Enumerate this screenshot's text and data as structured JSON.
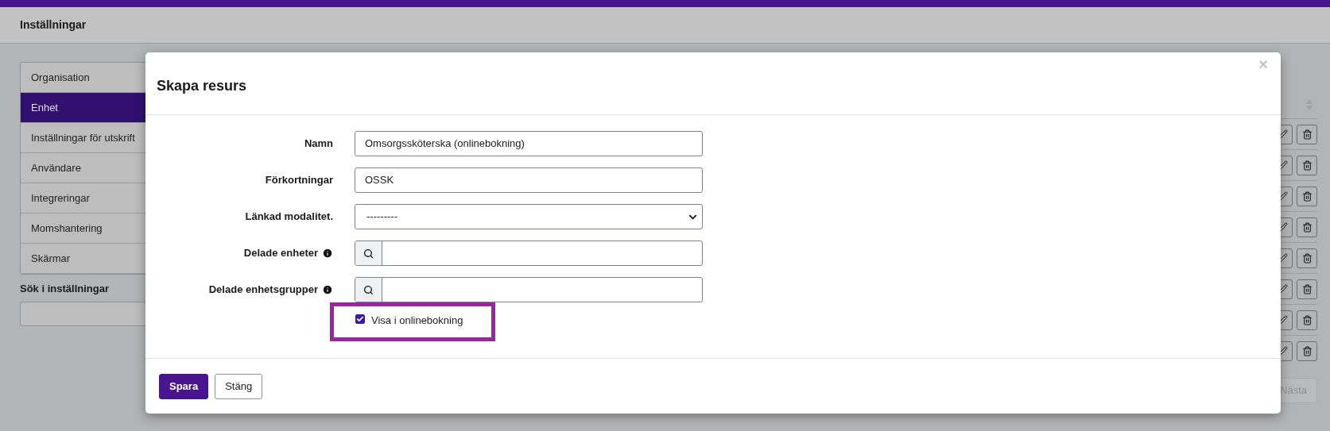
{
  "header": {
    "title": "Inställningar"
  },
  "sidebar": {
    "items": [
      {
        "label": "Organisation",
        "selected": false
      },
      {
        "label": "Enhet",
        "selected": true
      },
      {
        "label": "Inställningar för utskrift",
        "selected": false
      },
      {
        "label": "Användare",
        "selected": false
      },
      {
        "label": "Integreringar",
        "selected": false
      },
      {
        "label": "Momshantering",
        "selected": false
      },
      {
        "label": "Skärmar",
        "selected": false
      }
    ],
    "search": {
      "label": "Sök i inställningar"
    }
  },
  "table": {
    "rows": [
      {
        "kind": "actions"
      },
      {
        "kind": "actions"
      },
      {
        "kind": "actions"
      },
      {
        "kind": "actions"
      },
      {
        "kind": "actions"
      },
      {
        "kind": "actions"
      },
      {
        "kind": "actions"
      },
      {
        "kind": "actions"
      }
    ]
  },
  "pagination": {
    "next": {
      "label": "Nästa",
      "disabled": true
    }
  },
  "modal": {
    "title": "Skapa resurs",
    "close": "×",
    "fields": [
      {
        "kind": "text",
        "label": "Namn",
        "value": "Omsorgssköterska (onlinebokning)",
        "info": false
      },
      {
        "kind": "text",
        "label": "Förkortningar",
        "value": "OSSK",
        "info": false
      },
      {
        "kind": "select",
        "label": "Länkad modalitet.",
        "value": "---------",
        "info": false
      },
      {
        "kind": "search",
        "label": "Delade enheter",
        "info": true
      },
      {
        "kind": "search",
        "label": "Delade enhetsgrupper",
        "info": true
      }
    ],
    "checkbox": {
      "label": "Visa i onlinebokning",
      "checked": true,
      "highlighted": true
    },
    "buttons": [
      {
        "kind": "primary",
        "label": "Spara"
      },
      {
        "kind": "secondary",
        "label": "Stäng"
      }
    ]
  }
}
